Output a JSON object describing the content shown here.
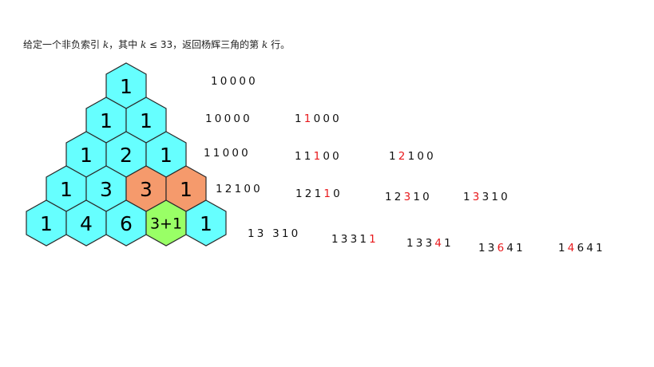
{
  "prompt": {
    "p1": "给定一个非负索引 ",
    "k1": "k",
    "p2": "，其中 ",
    "k2": "k",
    "p3": " ≤ 33，返回杨辉三角的第 ",
    "k3": "k",
    "p4": " 行。"
  },
  "colors": {
    "hex_default": "#66ffff",
    "hex_orange": "#f59a6c",
    "hex_green": "#99ff66",
    "hex_stroke": "#2a2a2a",
    "highlight_text": "#e8191c"
  },
  "triangle": {
    "rows": [
      [
        {
          "label": "1",
          "color": "default"
        }
      ],
      [
        {
          "label": "1",
          "color": "default"
        },
        {
          "label": "1",
          "color": "default"
        }
      ],
      [
        {
          "label": "1",
          "color": "default"
        },
        {
          "label": "2",
          "color": "default"
        },
        {
          "label": "1",
          "color": "default"
        }
      ],
      [
        {
          "label": "1",
          "color": "default"
        },
        {
          "label": "3",
          "color": "default"
        },
        {
          "label": "3",
          "color": "orange"
        },
        {
          "label": "1",
          "color": "orange"
        }
      ],
      [
        {
          "label": "1",
          "color": "default"
        },
        {
          "label": "4",
          "color": "default"
        },
        {
          "label": "6",
          "color": "default"
        },
        {
          "label": "3+1",
          "color": "green"
        },
        {
          "label": "1",
          "color": "default"
        }
      ]
    ]
  },
  "steps": [
    {
      "segments": [
        {
          "t": "10000",
          "hl": false
        }
      ]
    },
    {
      "segments": [
        {
          "t": "10000",
          "hl": false
        }
      ]
    },
    {
      "segments": [
        {
          "t": "1",
          "hl": false
        },
        {
          "t": "1",
          "hl": true
        },
        {
          "t": "000",
          "hl": false
        }
      ]
    },
    {
      "segments": [
        {
          "t": "11000",
          "hl": false
        }
      ]
    },
    {
      "segments": [
        {
          "t": "11",
          "hl": false
        },
        {
          "t": "1",
          "hl": true
        },
        {
          "t": "00",
          "hl": false
        }
      ]
    },
    {
      "segments": [
        {
          "t": "1",
          "hl": false
        },
        {
          "t": "2",
          "hl": true
        },
        {
          "t": "100",
          "hl": false
        }
      ]
    },
    {
      "segments": [
        {
          "t": "12100",
          "hl": false
        }
      ]
    },
    {
      "segments": [
        {
          "t": "121",
          "hl": false
        },
        {
          "t": "1",
          "hl": true
        },
        {
          "t": "0",
          "hl": false
        }
      ]
    },
    {
      "segments": [
        {
          "t": "12",
          "hl": false
        },
        {
          "t": "3",
          "hl": true
        },
        {
          "t": "10",
          "hl": false
        }
      ]
    },
    {
      "segments": [
        {
          "t": "1",
          "hl": false
        },
        {
          "t": "3",
          "hl": true
        },
        {
          "t": "310",
          "hl": false
        }
      ]
    },
    {
      "segments": [
        {
          "t": "13 310",
          "hl": false
        }
      ]
    },
    {
      "segments": [
        {
          "t": "1331",
          "hl": false
        },
        {
          "t": "1",
          "hl": true
        }
      ]
    },
    {
      "segments": [
        {
          "t": "133",
          "hl": false
        },
        {
          "t": "4",
          "hl": true
        },
        {
          "t": "1",
          "hl": false
        }
      ]
    },
    {
      "segments": [
        {
          "t": "13",
          "hl": false
        },
        {
          "t": "6",
          "hl": true
        },
        {
          "t": "41",
          "hl": false
        }
      ]
    },
    {
      "segments": [
        {
          "t": "1",
          "hl": false
        },
        {
          "t": "4",
          "hl": true
        },
        {
          "t": "641",
          "hl": false
        }
      ]
    }
  ]
}
